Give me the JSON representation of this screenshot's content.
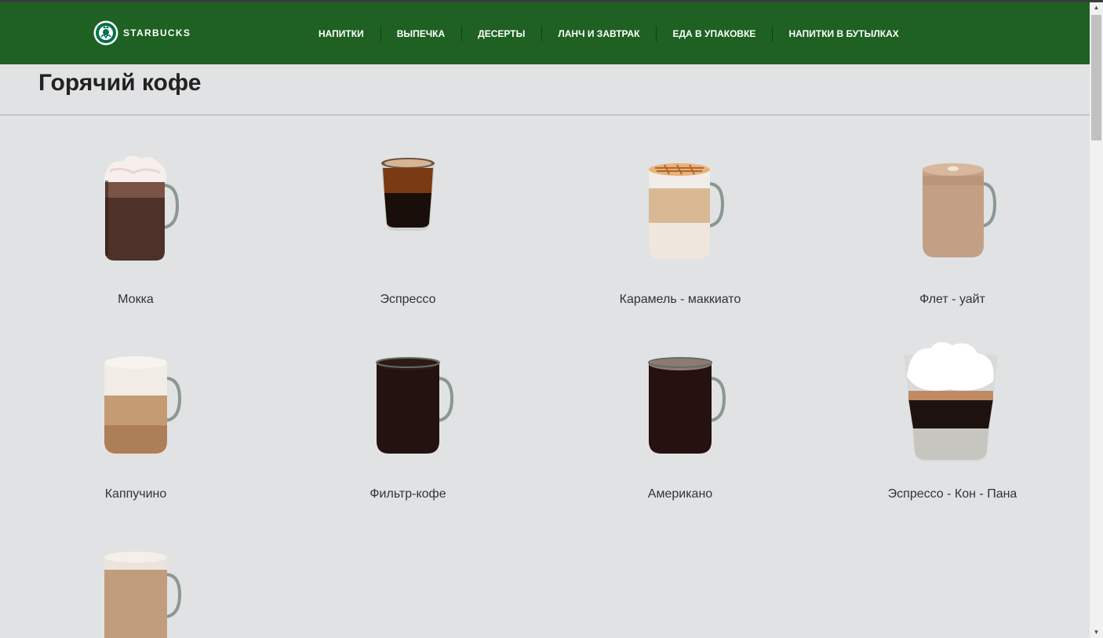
{
  "header": {
    "brand": "STARBUCKS",
    "nav": [
      "НАПИТКИ",
      "ВЫПЕЧКА",
      "ДЕСЕРТЫ",
      "ЛАНЧ И ЗАВТРАК",
      "ЕДА В УПАКОВКЕ",
      "НАПИТКИ В БУТЫЛКАХ"
    ]
  },
  "page": {
    "title": "Горячий кофе"
  },
  "products": [
    {
      "name": "Мокка",
      "icon": "mocha-mug-icon"
    },
    {
      "name": "Эспрессо",
      "icon": "espresso-shot-icon"
    },
    {
      "name": "Карамель - маккиато",
      "icon": "caramel-macchiato-mug-icon"
    },
    {
      "name": "Флет - уайт",
      "icon": "flat-white-mug-icon"
    },
    {
      "name": "Каппучино",
      "icon": "cappuccino-mug-icon"
    },
    {
      "name": "Фильтр-кофе",
      "icon": "filter-coffee-mug-icon"
    },
    {
      "name": "Американо",
      "icon": "americano-mug-icon"
    },
    {
      "name": "Эспрессо - Кон - Пана",
      "icon": "espresso-con-panna-glass-icon"
    },
    {
      "name": "",
      "icon": "latte-mug-icon"
    }
  ],
  "colors": {
    "header_bg": "#1e6122",
    "page_bg": "#e1e2e4",
    "brand_green": "#00704a"
  }
}
